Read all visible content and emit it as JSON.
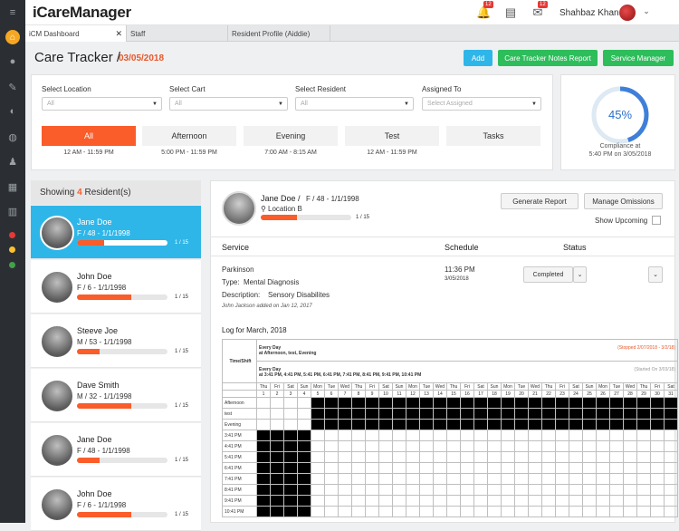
{
  "app": {
    "logo": "iCareManager",
    "user": "Shahbaz Khan",
    "notif_count": "12",
    "msg_count": "12"
  },
  "tabs": [
    {
      "label": "iCM Dashboard"
    },
    {
      "label": "Staff"
    },
    {
      "label": "Resident Profile (Aiddie)"
    }
  ],
  "page": {
    "title": "Care Tracker /",
    "date": "03/05/2018"
  },
  "actions": {
    "add": "Add",
    "notes_report": "Care Tracker Notes Report",
    "service_manager": "Service Manager"
  },
  "filters": {
    "location_label": "Select Location",
    "location_value": "All",
    "cart_label": "Select Cart",
    "cart_value": "All",
    "resident_label": "Select Resident",
    "resident_value": "All",
    "assigned_label": "Assigned To",
    "assigned_placeholder": "Select Assigned"
  },
  "shifts": [
    {
      "label": "All",
      "time": "12 AM - 11:59 PM"
    },
    {
      "label": "Afternoon",
      "time": "5:00 PM - 11:59 PM"
    },
    {
      "label": "Evening",
      "time": "7:00 AM - 8:15 AM"
    },
    {
      "label": "Test",
      "time": "12 AM - 11:59 PM"
    },
    {
      "label": "Tasks",
      "time": ""
    }
  ],
  "compliance": {
    "percent": "45%",
    "value": 0.45,
    "label": "Compliance at",
    "time": "5:40 PM on 3/05/2018"
  },
  "residents_header": {
    "prefix": "Showing",
    "count": "4",
    "suffix": "Resident(s)"
  },
  "residents": [
    {
      "name": "Jane Doe",
      "sub": "F / 48 - 1/1/1998",
      "progress": "1 / 15",
      "fill": 0.3
    },
    {
      "name": "John Doe",
      "sub": "F / 6 - 1/1/1998",
      "progress": "1 / 15",
      "fill": 0.6
    },
    {
      "name": "Steeve Joe",
      "sub": "M / 53 - 1/1/1998",
      "progress": "1 / 15",
      "fill": 0.25
    },
    {
      "name": "Dave Smith",
      "sub": "M / 32 - 1/1/1998",
      "progress": "1 / 15",
      "fill": 0.6
    },
    {
      "name": "Jane Doe",
      "sub": "F / 48 - 1/1/1998",
      "progress": "1 / 15",
      "fill": 0.25
    },
    {
      "name": "John Doe",
      "sub": "F / 6 - 1/1/1998",
      "progress": "1 / 15",
      "fill": 0.6
    }
  ],
  "detail": {
    "name": "Jane Doe /",
    "info": "F / 48 - 1/1/1998",
    "location": "Location B",
    "progress": "1 / 15",
    "fill": 0.4,
    "generate_report": "Generate Report",
    "manage_omissions": "Manage Omissions",
    "show_upcoming": "Show Upcoming",
    "col_service": "Service",
    "col_schedule": "Schedule",
    "col_status": "Status",
    "service_name": "Parkinson",
    "type_label": "Type:",
    "type_value": "Mental Diagnosis",
    "desc_label": "Description:",
    "desc_value": "Sensory Disabilites",
    "added_note": "John Jackson added on Jan 12, 2017",
    "sched_time": "11:36 PM",
    "sched_date": "3/05/2018",
    "status": "Completed",
    "log_title": "Log for March, 2018",
    "time_shift": "Time/Shift",
    "rule1_title": "Every Day",
    "rule1_detail": "at Afternoon, test, Evening",
    "rule1_range": "(Stopped 2/07/2018 - 3/2/18)",
    "rule2_title": "Every Day",
    "rule2_detail": "at 3:41 PM, 4:41 PM, 5:41 PM, 6:41 PM, 7:41 PM, 8:41 PM, 9:41 PM, 10:41 PM",
    "rule2_range": "(Started On 3/03/18)",
    "days": [
      "Thu",
      "Fri",
      "Sat",
      "Sun",
      "Mon",
      "Tue",
      "Wed",
      "Thu",
      "Fri",
      "Sat",
      "Sun",
      "Mon",
      "Tue",
      "Wed",
      "Thu",
      "Fri",
      "Sat",
      "Sun",
      "Mon",
      "Tue",
      "Wed",
      "Thu",
      "Fri",
      "Sat",
      "Sun",
      "Mon",
      "Tue",
      "Wed",
      "Thu",
      "Fri",
      "Sat"
    ],
    "dates": [
      "1",
      "2",
      "3",
      "4",
      "5",
      "6",
      "7",
      "8",
      "9",
      "10",
      "11",
      "12",
      "13",
      "14",
      "15",
      "16",
      "17",
      "18",
      "19",
      "20",
      "21",
      "22",
      "23",
      "24",
      "25",
      "26",
      "27",
      "28",
      "29",
      "30",
      "31"
    ],
    "rows": [
      {
        "label": "Afternoon",
        "black_from": 4,
        "black_to": 30
      },
      {
        "label": "test",
        "black_from": 4,
        "black_to": 30
      },
      {
        "label": "Evening",
        "black_from": 4,
        "black_to": 30
      },
      {
        "label": "3:41 PM",
        "black_from": 0,
        "black_to": 3
      },
      {
        "label": "4:41 PM",
        "black_from": 0,
        "black_to": 3
      },
      {
        "label": "5:41 PM",
        "black_from": 0,
        "black_to": 3
      },
      {
        "label": "6:41 PM",
        "black_from": 0,
        "black_to": 3
      },
      {
        "label": "7:41 PM",
        "black_from": 0,
        "black_to": 3
      },
      {
        "label": "8:41 PM",
        "black_from": 0,
        "black_to": 3
      },
      {
        "label": "9:41 PM",
        "black_from": 0,
        "black_to": 3
      },
      {
        "label": "10:41 PM",
        "black_from": 0,
        "black_to": 3
      }
    ]
  }
}
